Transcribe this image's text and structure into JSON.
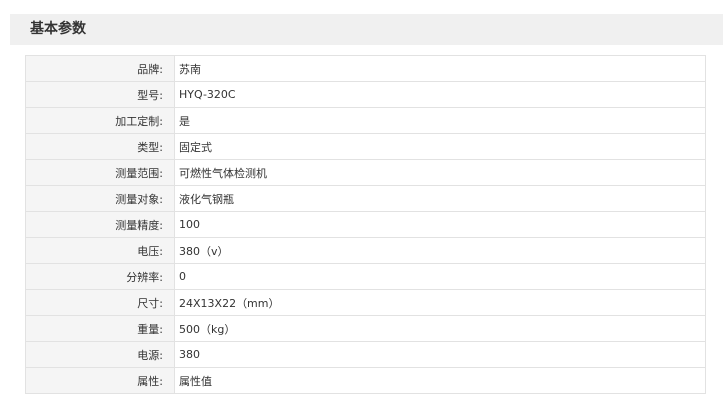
{
  "section": {
    "title": "基本参数"
  },
  "specs": [
    {
      "label": "品牌:",
      "value": "苏南"
    },
    {
      "label": "型号:",
      "value": "HYQ-320C"
    },
    {
      "label": "加工定制:",
      "value": "是"
    },
    {
      "label": "类型:",
      "value": "固定式"
    },
    {
      "label": "测量范围:",
      "value": "可燃性气体检测机"
    },
    {
      "label": "测量对象:",
      "value": "液化气钢瓶"
    },
    {
      "label": "测量精度:",
      "value": "100"
    },
    {
      "label": "电压:",
      "value": "380（v）"
    },
    {
      "label": "分辨率:",
      "value": "0"
    },
    {
      "label": "尺寸:",
      "value": "24X13X22（mm）"
    },
    {
      "label": "重量:",
      "value": "500（kg）"
    },
    {
      "label": "电源:",
      "value": "380"
    },
    {
      "label": "属性:",
      "value": "属性值"
    }
  ]
}
